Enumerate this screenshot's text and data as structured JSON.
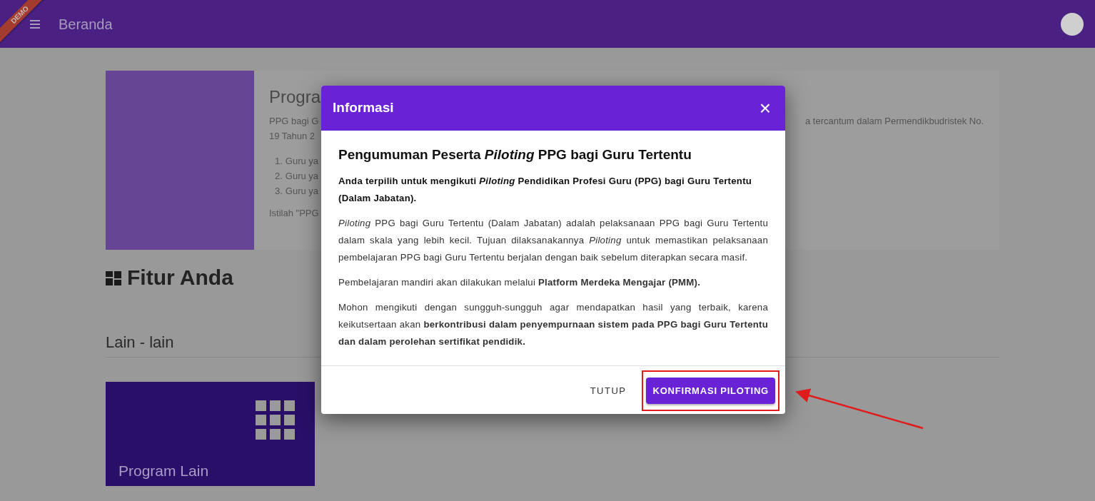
{
  "navbar": {
    "ribbon": "DEMO",
    "title": "Beranda"
  },
  "program_card": {
    "title": "Progra",
    "intro_lines": [
      "PPG bagi G",
      "19 Tahun 2"
    ],
    "intro_tail": "a tercantum dalam Permendikbudristek No.",
    "list": [
      {
        "marker": "1.",
        "text": "Guru ya"
      },
      {
        "marker": "2.",
        "text": "Guru ya"
      },
      {
        "marker": "3.",
        "text": "Guru ya"
      }
    ],
    "note": "Istilah \"PPG"
  },
  "features": {
    "heading": "Fitur Anda",
    "section": "Lain - lain",
    "tiles": [
      {
        "label": "Program Lain"
      }
    ]
  },
  "modal": {
    "title": "Informasi",
    "close": "×",
    "heading": "Pengumuman Peserta *Piloting* PPG bagi Guru Tertentu",
    "paragraphs": [
      {
        "kind": "lead",
        "text": "Anda terpilih untuk mengikuti *Piloting* Pendidikan Profesi Guru (PPG) bagi Guru Tertentu (Dalam Jabatan)."
      },
      {
        "kind": "body",
        "text": "*Piloting* PPG bagi Guru Tertentu (Dalam Jabatan) adalah pelaksanaan PPG bagi Guru Tertentu dalam skala yang lebih kecil. Tujuan dilaksanakannya *Piloting* untuk memastikan pelaksanaan pembelajaran PPG bagi Guru Tertentu berjalan dengan baik sebelum diterapkan secara masif."
      },
      {
        "kind": "body",
        "text": "Pembelajaran mandiri akan dilakukan melalui **Platform Merdeka Mengajar (PMM).**"
      },
      {
        "kind": "body",
        "text": "Mohon mengikuti dengan sungguh-sungguh agar mendapatkan hasil yang terbaik, karena keikutsertaan akan **berkontribusi dalam penyempurnaan sistem pada PPG bagi Guru Tertentu dan dalam perolehan sertifikat pendidik.**"
      }
    ],
    "buttons": [
      {
        "label": "TUTUP",
        "kind": "text",
        "highlighted": false
      },
      {
        "label": "KONFIRMASI PILOTING",
        "kind": "primary",
        "highlighted": true
      }
    ]
  }
}
